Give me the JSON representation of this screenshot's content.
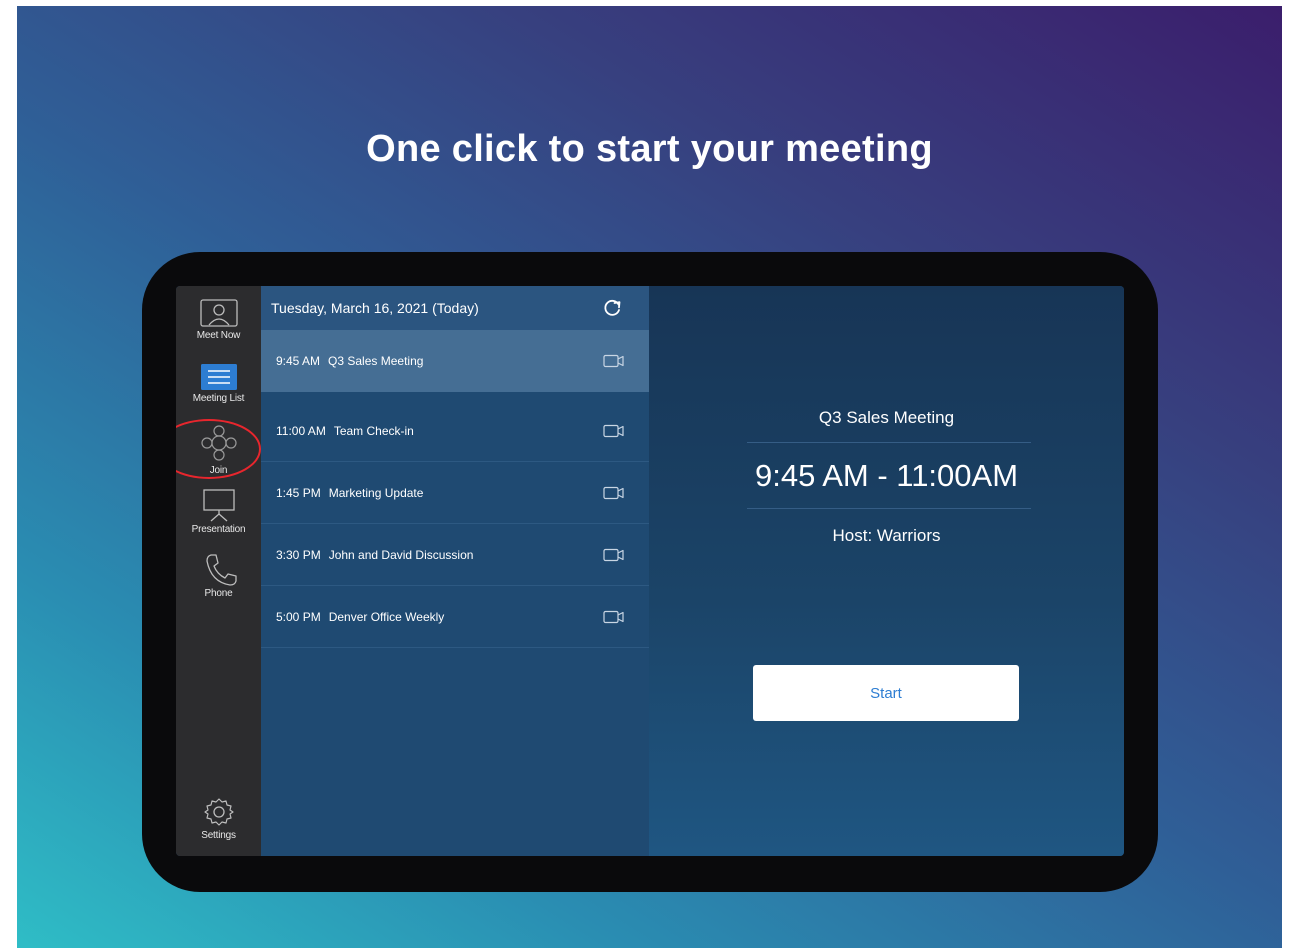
{
  "headline": "One click to start your meeting",
  "colors": {
    "highlight_ring": "#e8262d",
    "accent_blue": "#2d7dd2",
    "sidebar_bg": "#2c2c2e",
    "list_bg": "#1f4a72",
    "selected_row_bg": "#456e94"
  },
  "sidebar": {
    "items": [
      {
        "label": "Meet Now",
        "icon": "person-screen-icon"
      },
      {
        "label": "Meeting List",
        "icon": "list-icon",
        "active": true
      },
      {
        "label": "Join",
        "icon": "join-icon",
        "highlighted": true
      },
      {
        "label": "Presentation",
        "icon": "presentation-icon"
      },
      {
        "label": "Phone",
        "icon": "phone-icon"
      },
      {
        "label": "Settings",
        "icon": "gear-icon"
      }
    ]
  },
  "meeting_list": {
    "date": "Tuesday, March 16, 2021 (Today)",
    "refresh_icon": "refresh-icon",
    "meetings": [
      {
        "time": "9:45 AM",
        "title": "Q3 Sales Meeting",
        "icon": "video-camera-icon",
        "selected": true
      },
      {
        "time": "11:00 AM",
        "title": "Team Check-in",
        "icon": "video-camera-icon"
      },
      {
        "time": "1:45 PM",
        "title": "Marketing Update",
        "icon": "video-camera-icon"
      },
      {
        "time": "3:30 PM",
        "title": "John and David Discussion",
        "icon": "video-camera-icon"
      },
      {
        "time": "5:00 PM",
        "title": "Denver Office Weekly",
        "icon": "video-camera-icon"
      }
    ]
  },
  "detail": {
    "title": "Q3 Sales Meeting",
    "time_range": "9:45 AM - 11:00AM",
    "host": "Host: Warriors",
    "start_label": "Start"
  }
}
